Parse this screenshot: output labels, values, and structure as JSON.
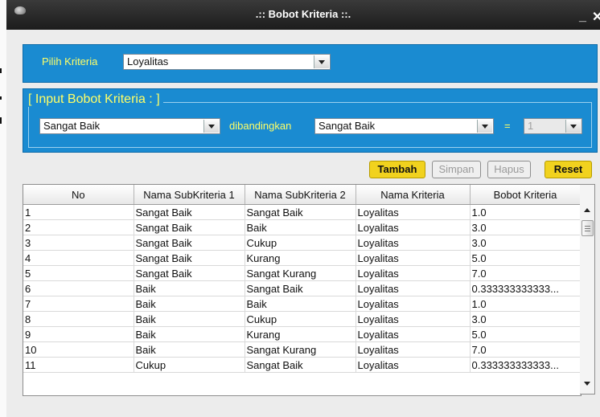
{
  "window": {
    "title": ".:: Bobot Kriteria ::."
  },
  "kriteria_panel": {
    "label": "Pilih Kriteria",
    "selected": "Loyalitas"
  },
  "input_panel": {
    "legend": "[ Input Bobot Kriteria : ]",
    "sub1_selected": "Sangat Baik",
    "compare_label": "dibandingkan",
    "sub2_selected": "Sangat Baik",
    "equals": "=",
    "value_selected": "1"
  },
  "buttons": {
    "tambah": "Tambah",
    "simpan": "Simpan",
    "hapus": "Hapus",
    "reset": "Reset"
  },
  "table": {
    "columns": [
      "No",
      "Nama SubKriteria 1",
      "Nama SubKriteria 2",
      "Nama Kriteria",
      "Bobot Kriteria"
    ],
    "rows": [
      [
        "1",
        "Sangat Baik",
        "Sangat Baik",
        "Loyalitas",
        "1.0"
      ],
      [
        "2",
        "Sangat Baik",
        "Baik",
        "Loyalitas",
        "3.0"
      ],
      [
        "3",
        "Sangat Baik",
        "Cukup",
        "Loyalitas",
        "3.0"
      ],
      [
        "4",
        "Sangat Baik",
        "Kurang",
        "Loyalitas",
        "5.0"
      ],
      [
        "5",
        "Sangat Baik",
        "Sangat Kurang",
        "Loyalitas",
        "7.0"
      ],
      [
        "6",
        "Baik",
        "Sangat Baik",
        "Loyalitas",
        "0.333333333333..."
      ],
      [
        "7",
        "Baik",
        "Baik",
        "Loyalitas",
        "1.0"
      ],
      [
        "8",
        "Baik",
        "Cukup",
        "Loyalitas",
        "3.0"
      ],
      [
        "9",
        "Baik",
        "Kurang",
        "Loyalitas",
        "5.0"
      ],
      [
        "10",
        "Baik",
        "Sangat Kurang",
        "Loyalitas",
        "7.0"
      ],
      [
        "11",
        "Cukup",
        "Sangat Baik",
        "Loyalitas",
        "0.333333333333..."
      ]
    ]
  },
  "colors": {
    "panel": "#1a8bd1",
    "label": "#ffff66",
    "primary_button": "#f1d21e"
  }
}
